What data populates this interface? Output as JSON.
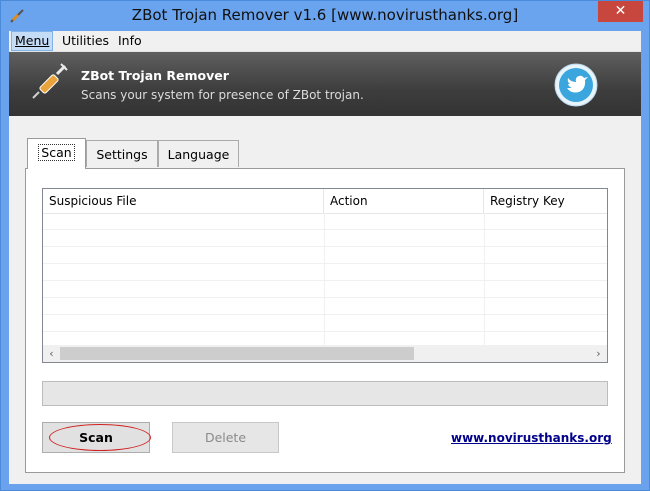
{
  "window": {
    "title": "ZBot Trojan Remover v1.6 [www.novirusthanks.org]",
    "close_label": "✕"
  },
  "menu": {
    "items": [
      {
        "label": "Menu",
        "underline": "M"
      },
      {
        "label": "Utilities",
        "underline": "U"
      },
      {
        "label": "Info",
        "underline": "I"
      }
    ]
  },
  "banner": {
    "title": "ZBot Trojan Remover",
    "subtitle": "Scans your system for presence of ZBot trojan.",
    "icon": "syringe-icon",
    "social_icon": "twitter-bird-icon"
  },
  "tabs": [
    {
      "label": "Scan",
      "active": true
    },
    {
      "label": "Settings",
      "active": false
    },
    {
      "label": "Language",
      "active": false
    }
  ],
  "results_table": {
    "columns": [
      "Suspicious File",
      "Action",
      "Registry Key"
    ],
    "rows": []
  },
  "scrollbar": {
    "left_arrow": "‹",
    "right_arrow": "›"
  },
  "progress": {
    "value": 0
  },
  "buttons": {
    "scan_label": "Scan",
    "delete_label": "Delete"
  },
  "footer": {
    "link_text": "www.novirusthanks.org"
  },
  "colors": {
    "title_bar": "#6aa4ef",
    "close_button": "#c7463d",
    "banner": "#3d3d3d",
    "link": "#00008b",
    "scan_highlight": "#d02020"
  }
}
